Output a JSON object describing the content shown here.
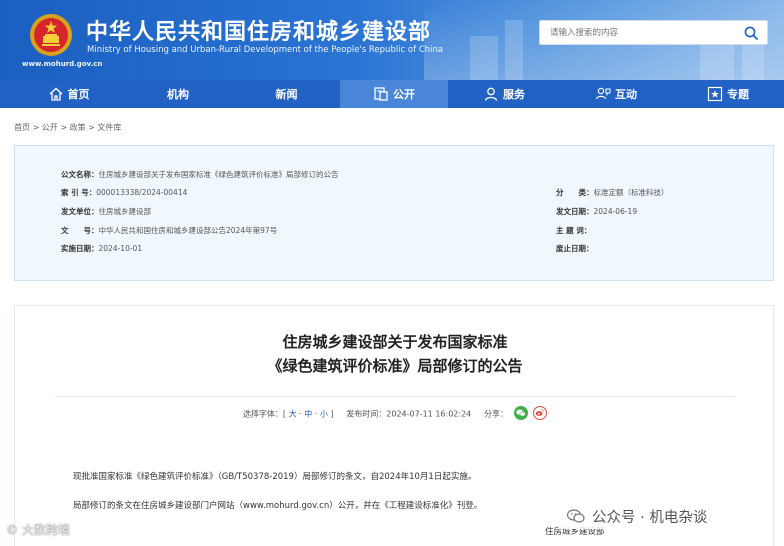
{
  "header": {
    "title": "中华人民共和国住房和城乡建设部",
    "subtitle": "Ministry of Housing and Urban-Rural Development of the People's Republic of China",
    "url": "www.mohurd.gov.cn",
    "search_placeholder": "请输入搜索的内容",
    "colors": {
      "primary": "#2162c4",
      "nav_active": "#4a86d8"
    }
  },
  "nav": {
    "items": [
      {
        "label": "首页",
        "icon": "home-icon"
      },
      {
        "label": "机构",
        "icon": ""
      },
      {
        "label": "新闻",
        "icon": ""
      },
      {
        "label": "公开",
        "icon": "document-icon"
      },
      {
        "label": "服务",
        "icon": "user-icon"
      },
      {
        "label": "互动",
        "icon": "chat-icon"
      },
      {
        "label": "专题",
        "icon": "star-icon"
      }
    ],
    "active": "公开"
  },
  "breadcrumb": [
    "首页",
    "公开",
    "政策",
    "文件库"
  ],
  "meta": {
    "title_label": "公文名称：",
    "title_value": "住房城乡建设部关于发布国家标准《绿色建筑评价标准》局部修订的公告",
    "index_label": "索 引 号：",
    "index_value": "000013338/2024-00414",
    "category_label": "分　　类：",
    "category_value": "标准定额（标准科技）",
    "issuer_label": "发文单位：",
    "issuer_value": "住房城乡建设部",
    "date_label": "发文日期：",
    "date_value": "2024-06-19",
    "doc_no_label": "文　　号：",
    "doc_no_value": "中华人民共和国住房和城乡建设部公告2024年第97号",
    "subject_label": "主 题 词：",
    "subject_value": "",
    "effective_label": "实施日期：",
    "effective_value": "2024-10-01",
    "expire_label": "废止日期：",
    "expire_value": ""
  },
  "article": {
    "title_line1": "住房城乡建设部关于发布国家标准",
    "title_line2": "《绿色建筑评价标准》局部修订的公告",
    "font_label": "选择字体：[",
    "font_large": "大",
    "font_medium": "中",
    "font_small": "小",
    "font_end": "]",
    "publish_time": "发布时间：2024-07-11 16:02:24",
    "share_label": "分享：",
    "paragraph1": "现批准国家标准《绿色建筑评价标准》（GB/T50378-2019）局部修订的条文，自2024年10月1日起实施。",
    "paragraph2": "局部修订的条文在住房城乡建设部门户网站（www.mohurd.gov.cn）公开，并在《工程建设标准化》刊登。",
    "signature": "住房城乡建设部"
  },
  "watermarks": {
    "left": "大数跨境",
    "right": "公众号 · 机电杂谈"
  }
}
